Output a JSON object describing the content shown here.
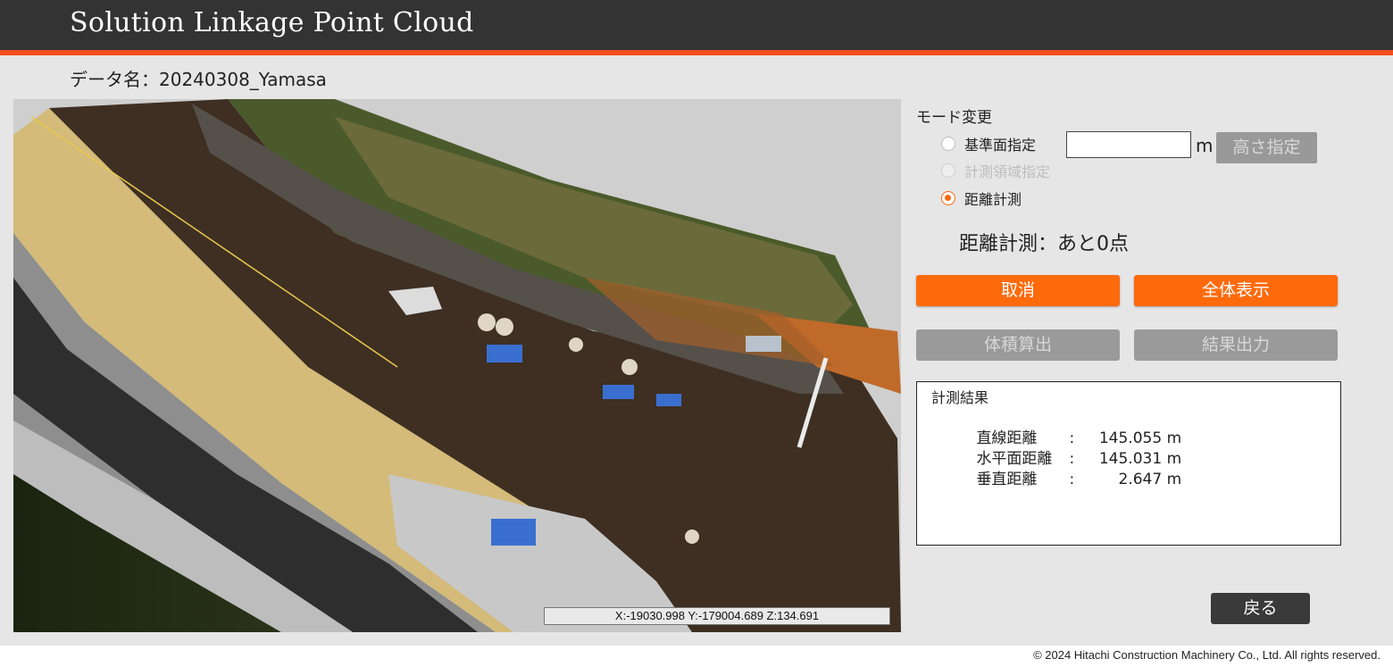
{
  "header": {
    "title": "Solution Linkage Point Cloud"
  },
  "data_name": "データ名：20240308_Yamasa",
  "viewer": {
    "coordinates": "X:-19030.998 Y:-179004.689 Z:134.691"
  },
  "panel": {
    "mode_label": "モード変更",
    "modes": [
      {
        "label": "基準面指定",
        "selected": false,
        "enabled": true
      },
      {
        "label": "計測領域指定",
        "selected": false,
        "enabled": false
      },
      {
        "label": "距離計測",
        "selected": true,
        "enabled": true
      }
    ],
    "height_input_value": "",
    "height_unit": "m",
    "height_button": "高さ指定",
    "measure_status": "距離計測：あと0点",
    "buttons": {
      "cancel": "取消",
      "fit_all": "全体表示",
      "volume": "体積算出",
      "export": "結果出力"
    },
    "results": {
      "title": "計測結果",
      "rows": [
        {
          "label": "直線距離",
          "sep": ":",
          "value": "145.055",
          "unit": "m"
        },
        {
          "label": "水平面距離",
          "sep": ":",
          "value": "145.031",
          "unit": "m"
        },
        {
          "label": "垂直距離",
          "sep": ":",
          "value": "2.647",
          "unit": "m"
        }
      ]
    },
    "back_button": "戻る"
  },
  "footer": {
    "copyright": "© 2024 Hitachi Construction Machinery Co., Ltd. All rights reserved."
  },
  "colors": {
    "accent": "#f04e1e",
    "button_orange": "#ff6a0d",
    "header_bg": "#333333"
  }
}
